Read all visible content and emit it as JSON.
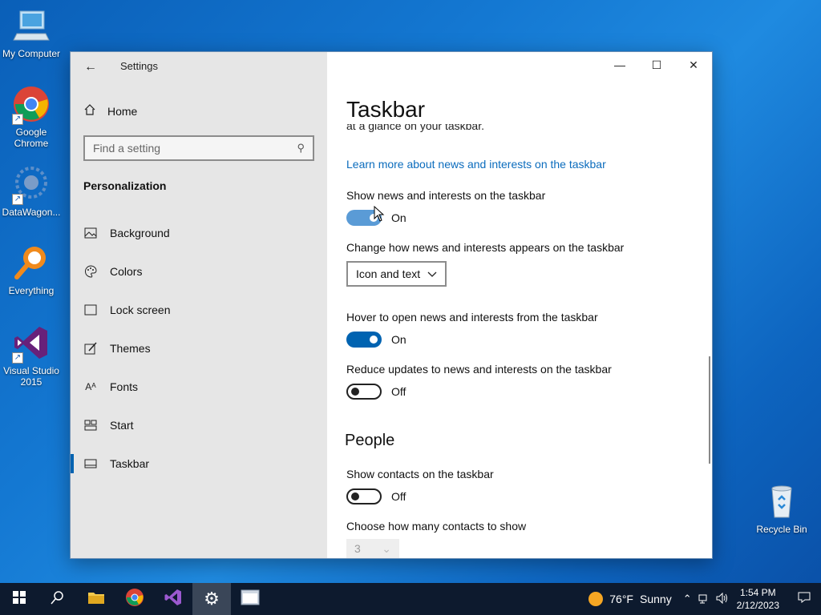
{
  "desktop": {
    "icons": [
      {
        "label": "My Computer"
      },
      {
        "label": "Google Chrome"
      },
      {
        "label": "DataWagon..."
      },
      {
        "label": "Everything"
      },
      {
        "label": "Visual Studio 2015"
      },
      {
        "label": "Recycle Bin"
      }
    ]
  },
  "window": {
    "title": "Settings",
    "controls": {
      "minimize": "—",
      "maximize": "☐",
      "close": "✕"
    }
  },
  "sidebar": {
    "home_label": "Home",
    "search_placeholder": "Find a setting",
    "section_label": "Personalization",
    "items": [
      {
        "label": "Background",
        "icon": "background-icon"
      },
      {
        "label": "Colors",
        "icon": "palette-icon"
      },
      {
        "label": "Lock screen",
        "icon": "lock-screen-icon"
      },
      {
        "label": "Themes",
        "icon": "themes-icon"
      },
      {
        "label": "Fonts",
        "icon": "fonts-icon"
      },
      {
        "label": "Start",
        "icon": "start-icon"
      },
      {
        "label": "Taskbar",
        "icon": "taskbar-icon",
        "active": true
      }
    ]
  },
  "main": {
    "title": "Taskbar",
    "cut_text": "at a glance on your taskbar.",
    "learn_link": "Learn more about news and interests on the taskbar",
    "show_news_label": "Show news and interests on the taskbar",
    "show_news_state": "On",
    "appearance_label": "Change how news and interests appears on the taskbar",
    "appearance_value": "Icon and text",
    "hover_label": "Hover to open news and interests from the taskbar",
    "hover_state": "On",
    "reduce_label": "Reduce updates to news and interests on the taskbar",
    "reduce_state": "Off",
    "people_heading": "People",
    "contacts_label": "Show contacts on the taskbar",
    "contacts_state": "Off",
    "contacts_count_label": "Choose how many contacts to show",
    "contacts_count_value": "3"
  },
  "taskbar": {
    "weather_temp": "76°F",
    "weather_desc": "Sunny",
    "time": "1:54 PM",
    "date": "2/12/2023"
  },
  "colors": {
    "accent": "#0063b1",
    "link": "#0b6cbd",
    "sidebar_bg": "#e6e6e6"
  }
}
